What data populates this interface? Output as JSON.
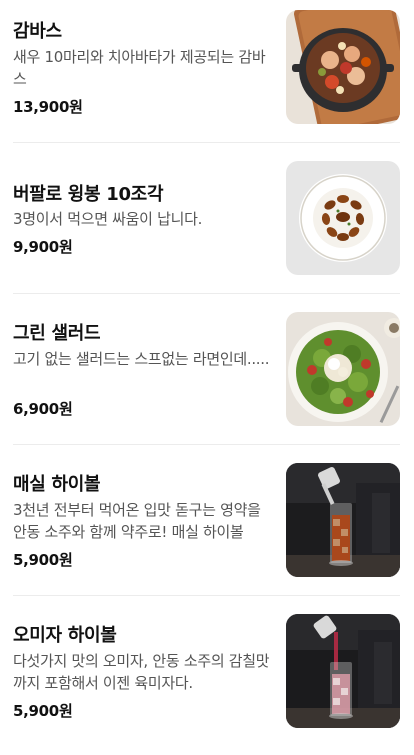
{
  "menu": {
    "items": [
      {
        "name": "감바스",
        "description": "새우 10마리와 치아바타가 제공되는 감바스",
        "price": "13,900원",
        "image": "gambas-skillet-photo"
      },
      {
        "name": "버팔로 윙봉 10조각",
        "description": "3명이서 먹으면 싸움이 납니다.",
        "price": "9,900원",
        "image": "buffalo-wings-plate-photo"
      },
      {
        "name": "그린 샐러드",
        "description": "고기 없는 샐러드는 스프없는 라면인데.....",
        "price": "6,900원",
        "image": "green-salad-bowl-photo"
      },
      {
        "name": "매실 하이볼",
        "description": "3천년 전부터 먹어온 입맛 돋구는 영약을 안동 소주와 함께 약주로! 매실 하이볼",
        "price": "5,900원",
        "image": "plum-highball-glass-photo"
      },
      {
        "name": "오미자 하이볼",
        "description": "다섯가지 맛의 오미자, 안동 소주의 감칠맛까지 포함해서 이젠 육미자다.",
        "price": "5,900원",
        "image": "omija-highball-glass-photo"
      }
    ]
  }
}
